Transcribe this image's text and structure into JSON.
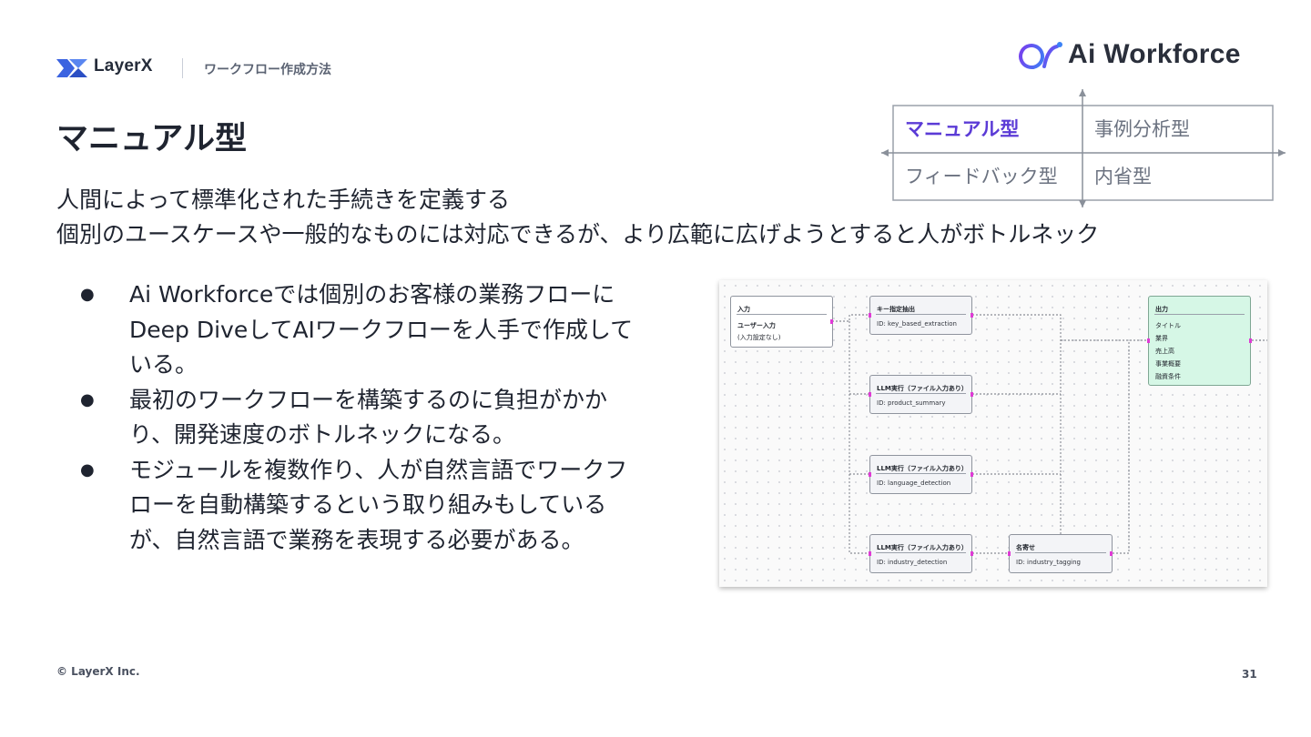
{
  "header": {
    "logo_text": "LayerX",
    "section_title": "ワークフロー作成方法",
    "brand_text": "Ai Workforce"
  },
  "title": "マニュアル型",
  "matrix": {
    "top_left": "マニュアル型",
    "top_right": "事例分析型",
    "bottom_left": "フィードバック型",
    "bottom_right": "内省型",
    "highlight_color": "#5b3bd6"
  },
  "subtitle": {
    "line1": "人間によって標準化された手続きを定義する",
    "line2": "個別のユースケースや一般的なものには対応できるが、より広範に広げようとすると人がボトルネック"
  },
  "bullets": [
    {
      "marker": "●",
      "lines": [
        "Ai Workforceでは個別のお客様の業務フローに",
        "Deep DiveしてAIワークフローを人手で作成して",
        "いる。"
      ]
    },
    {
      "marker": "●",
      "lines": [
        "最初のワークフローを構築するのに負担がかか",
        "り、開発速度のボトルネックになる。"
      ]
    },
    {
      "marker": "●",
      "lines": [
        "モジュールを複数作り、人が自然言語でワークフ",
        "ローを自動構築するという取り組みもしている",
        "が、自然言語で業務を表現する必要がある。"
      ]
    }
  ],
  "workflow": {
    "input_node": {
      "title": "入力",
      "label": "ユーザー入力",
      "note": "(入力設定なし)"
    },
    "nodes": [
      {
        "title": "キー指定抽出",
        "id": "ID: key_based_extraction"
      },
      {
        "title": "LLM実行（ファイル入力あり）",
        "id": "ID: product_summary"
      },
      {
        "title": "LLM実行（ファイル入力あり）",
        "id": "ID: language_detection"
      },
      {
        "title": "LLM実行（ファイル入力あり）",
        "id": "ID: industry_detection"
      },
      {
        "title": "名寄せ",
        "id": "ID: industry_tagging"
      }
    ],
    "output_node": {
      "title": "出力",
      "fields": [
        "タイトル",
        "業界",
        "売上高",
        "事業概要",
        "融資条件"
      ]
    }
  },
  "footer": {
    "copyright": "© LayerX Inc.",
    "page_number": "31"
  }
}
